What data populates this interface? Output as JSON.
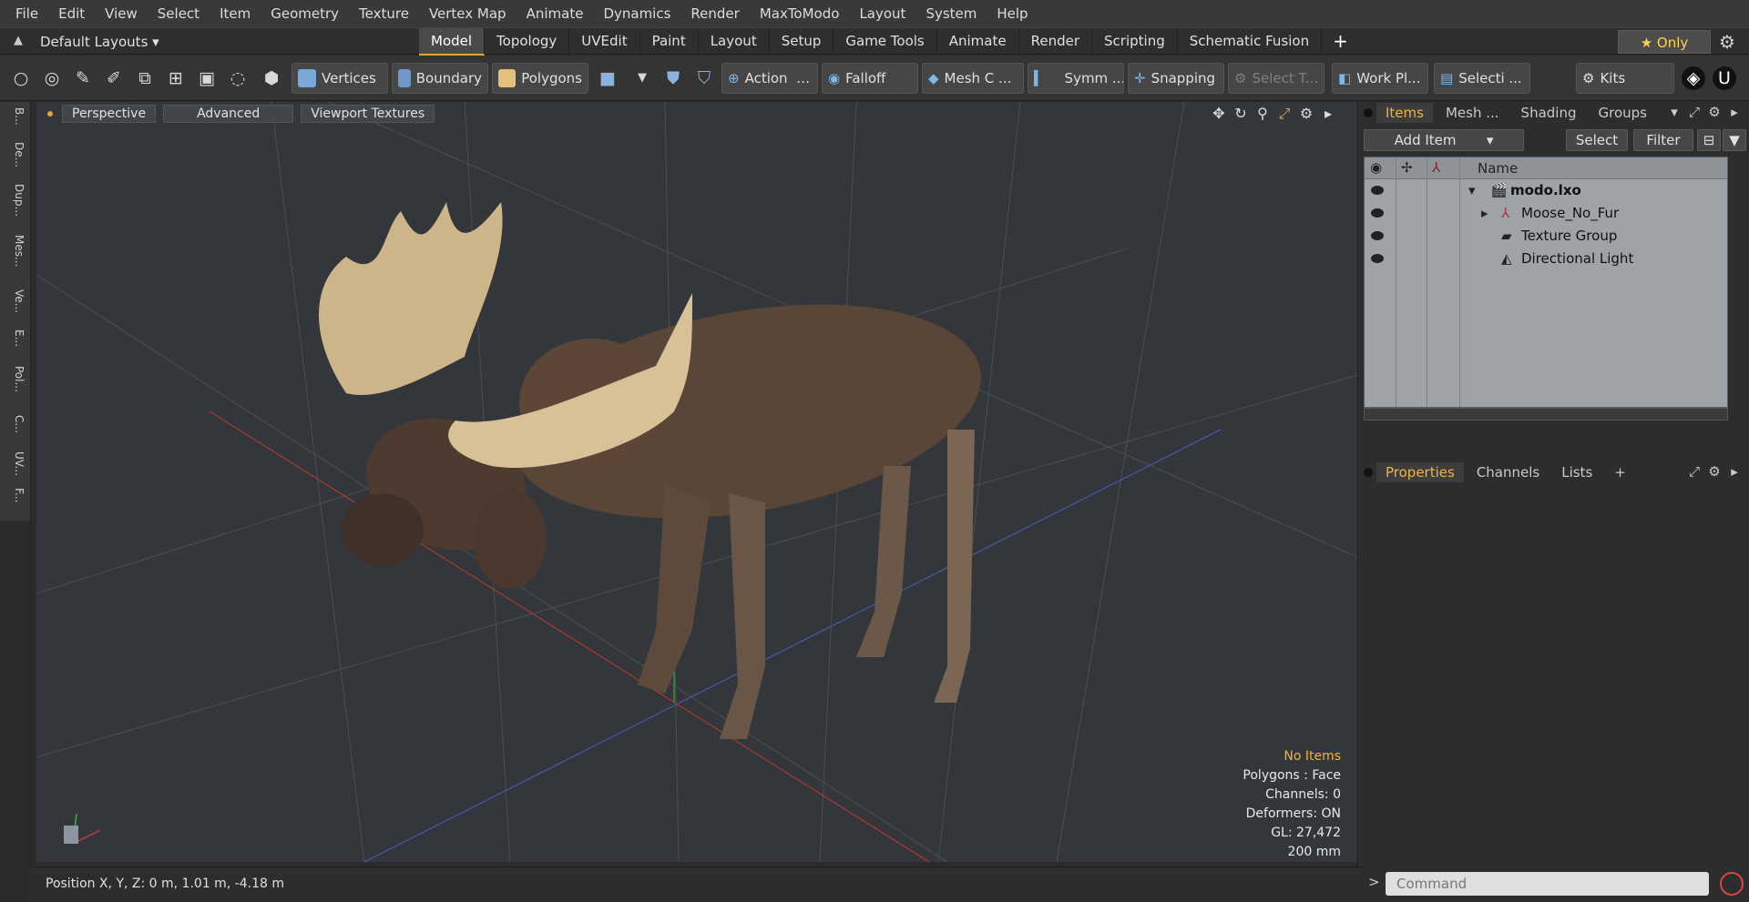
{
  "menubar": {
    "items": [
      "File",
      "Edit",
      "View",
      "Select",
      "Item",
      "Geometry",
      "Texture",
      "Vertex Map",
      "Animate",
      "Dynamics",
      "Render",
      "MaxToModo",
      "Layout",
      "System",
      "Help"
    ]
  },
  "tabbar": {
    "layouts_label": "Default Layouts",
    "tabs": [
      {
        "label": "Model",
        "active": true
      },
      {
        "label": "Topology"
      },
      {
        "label": "UVEdit"
      },
      {
        "label": "Paint"
      },
      {
        "label": "Layout"
      },
      {
        "label": "Setup"
      },
      {
        "label": "Game Tools"
      },
      {
        "label": "Animate"
      },
      {
        "label": "Render"
      },
      {
        "label": "Scripting"
      },
      {
        "label": "Schematic Fusion"
      }
    ],
    "only_label": "★ Only"
  },
  "toolbar": {
    "vertices": "Vertices",
    "boundary": "Boundary",
    "polygons": "Polygons",
    "action": "Action",
    "falloff": "Falloff",
    "mesh": "Mesh C ...",
    "symm": "Symm ...",
    "snapping": "Snapping",
    "select_t": "Select T...",
    "workplane": "Work Pl...",
    "selecti": "Selecti ...",
    "kits": "Kits"
  },
  "left_tabs": [
    "B...",
    "De...",
    "Dup...",
    "Mes...",
    "Ve...",
    "E...",
    "Pol...",
    "C...",
    "UV...",
    "F..."
  ],
  "viewport": {
    "perspective": "Perspective",
    "advanced": "Advanced",
    "textures": "Viewport Textures",
    "info": {
      "no_items": "No Items",
      "polygons": "Polygons : Face",
      "channels": "Channels: 0",
      "deformers": "Deformers: ON",
      "gl": "GL: 27,472",
      "scale": "200 mm"
    }
  },
  "items_panel": {
    "tabs": [
      "Items",
      "Mesh ...",
      "Shading",
      "Groups"
    ],
    "add_item": "Add Item",
    "select": "Select",
    "filter": "Filter",
    "name_col": "Name",
    "rows": [
      {
        "label": "modo.lxo",
        "bold": true
      },
      {
        "label": "Moose_No_Fur"
      },
      {
        "label": "Texture Group"
      },
      {
        "label": "Directional Light"
      }
    ]
  },
  "properties_panel": {
    "tabs": [
      "Properties",
      "Channels",
      "Lists"
    ]
  },
  "statusbar": {
    "position": "Position X, Y, Z:  0 m, 1.01 m, -4.18 m"
  },
  "command": {
    "placeholder": "Command"
  }
}
